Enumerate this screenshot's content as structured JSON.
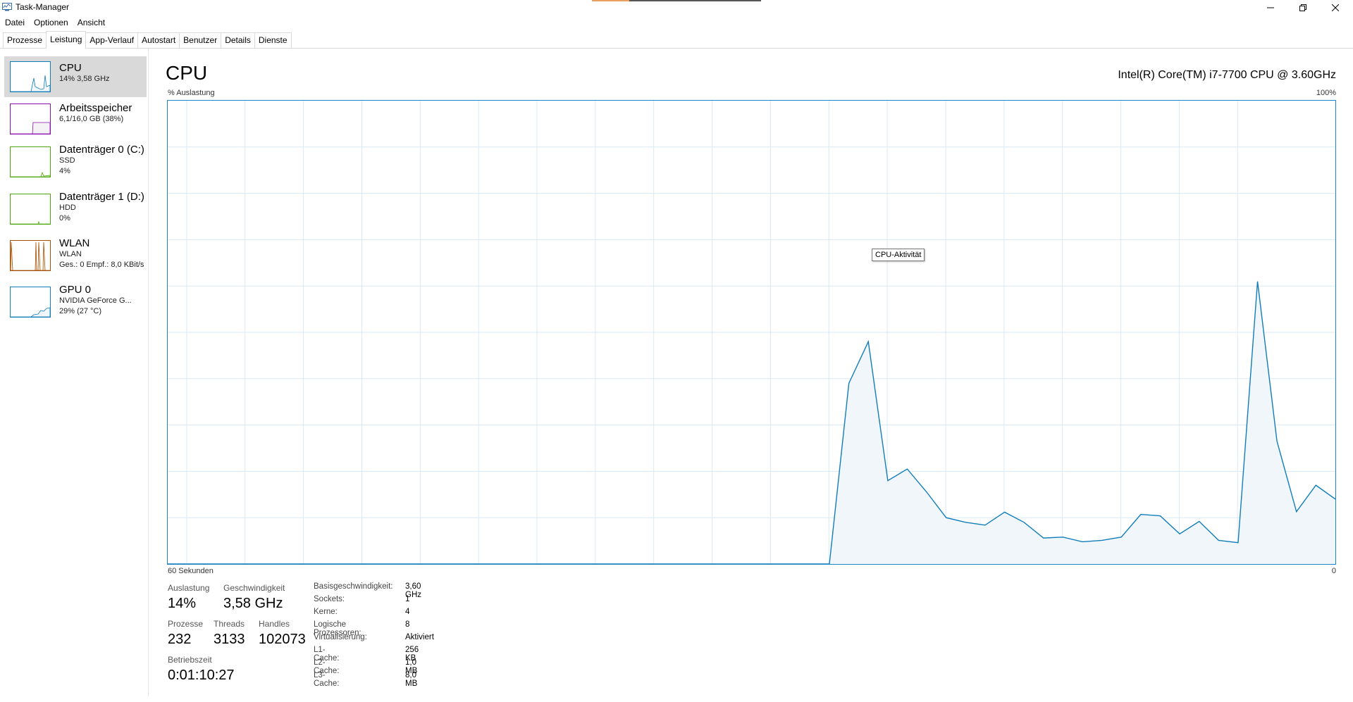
{
  "window": {
    "title": "Task-Manager"
  },
  "menu": [
    "Datei",
    "Optionen",
    "Ansicht"
  ],
  "tabs": [
    {
      "label": "Prozesse"
    },
    {
      "label": "Leistung",
      "active": true
    },
    {
      "label": "App-Verlauf"
    },
    {
      "label": "Autostart"
    },
    {
      "label": "Benutzer"
    },
    {
      "label": "Details"
    },
    {
      "label": "Dienste"
    }
  ],
  "sidebar": {
    "items": [
      {
        "title": "CPU",
        "lines": [
          "14% 3,58 GHz"
        ],
        "color": "#117dbb",
        "selected": true
      },
      {
        "title": "Arbeitsspeicher",
        "lines": [
          "6,1/16,0 GB (38%)"
        ],
        "color": "#8b12ae"
      },
      {
        "title": "Datenträger 0 (C:)",
        "lines": [
          "SSD",
          "4%"
        ],
        "color": "#4da60c"
      },
      {
        "title": "Datenträger 1 (D:)",
        "lines": [
          "HDD",
          "0%"
        ],
        "color": "#4da60c"
      },
      {
        "title": "WLAN",
        "lines": [
          "WLAN",
          "Ges.: 0 Empf.: 8,0 KBit/s"
        ],
        "color": "#a74f01"
      },
      {
        "title": "GPU 0",
        "lines": [
          "NVIDIA GeForce G...",
          "29% (27 °C)"
        ],
        "color": "#117dbb"
      }
    ]
  },
  "main": {
    "title": "CPU",
    "cpu_model": "Intel(R) Core(TM) i7-7700 CPU @ 3.60GHz",
    "y_axis_label": "% Auslastung",
    "y_max_label": "100%",
    "x_left_label": "60 Sekunden",
    "x_right_label": "0",
    "tooltip": "CPU-Aktivität",
    "stats": {
      "utilization": {
        "label": "Auslastung",
        "value": "14%"
      },
      "speed": {
        "label": "Geschwindigkeit",
        "value": "3,58 GHz"
      },
      "processes": {
        "label": "Prozesse",
        "value": "232"
      },
      "threads": {
        "label": "Threads",
        "value": "3133"
      },
      "handles": {
        "label": "Handles",
        "value": "102073"
      },
      "uptime": {
        "label": "Betriebszeit",
        "value": "0:01:10:27"
      }
    },
    "info": [
      {
        "label": "Basisgeschwindigkeit:",
        "value": "3,60 GHz"
      },
      {
        "label": "Sockets:",
        "value": "1"
      },
      {
        "label": "Kerne:",
        "value": "4"
      },
      {
        "label": "Logische Prozessoren:",
        "value": "8"
      },
      {
        "label": "Virtualisierung:",
        "value": "Aktiviert"
      },
      {
        "label": "L1-Cache:",
        "value": "256 KB"
      },
      {
        "label": "L2-Cache:",
        "value": "1,0 MB"
      },
      {
        "label": "L3-Cache:",
        "value": "8,0 MB"
      }
    ]
  },
  "colors": {
    "cpu_line": "#117dbb",
    "cpu_fill": "#f1f6fa",
    "grid": "#d9eaf4"
  },
  "chart_data": {
    "type": "area",
    "x_range": [
      60,
      0
    ],
    "ylim": [
      0,
      100
    ],
    "grid": true,
    "series": [
      {
        "x": [
          60,
          59,
          58,
          57,
          56,
          55,
          54,
          53,
          52,
          51,
          50,
          49,
          48,
          47,
          46,
          45,
          44,
          43,
          42,
          41,
          40,
          39,
          38,
          37,
          36,
          35,
          34,
          33,
          32,
          31,
          30,
          29,
          28,
          27,
          26,
          25,
          24,
          23,
          22,
          21,
          20,
          19,
          18,
          17,
          16,
          15,
          14,
          13,
          12,
          11,
          10,
          9,
          8,
          7,
          6,
          5,
          4,
          3,
          2,
          1,
          0
        ],
        "values": [
          0,
          0,
          0,
          0,
          0,
          0,
          0,
          0,
          0,
          0,
          0,
          0,
          0,
          0,
          0,
          0,
          0,
          0,
          0,
          0,
          0,
          0,
          0,
          0,
          0,
          0,
          0,
          0,
          0,
          0,
          0,
          0,
          0,
          0,
          0,
          39,
          48,
          18,
          20.5,
          15.5,
          10,
          9,
          8.4,
          11.2,
          9,
          5.6,
          5.8,
          4.8,
          5.1,
          5.8,
          10.7,
          10.4,
          6.5,
          9.2,
          5.1,
          4.6,
          61,
          26.5,
          11.3,
          17,
          14
        ]
      }
    ]
  }
}
